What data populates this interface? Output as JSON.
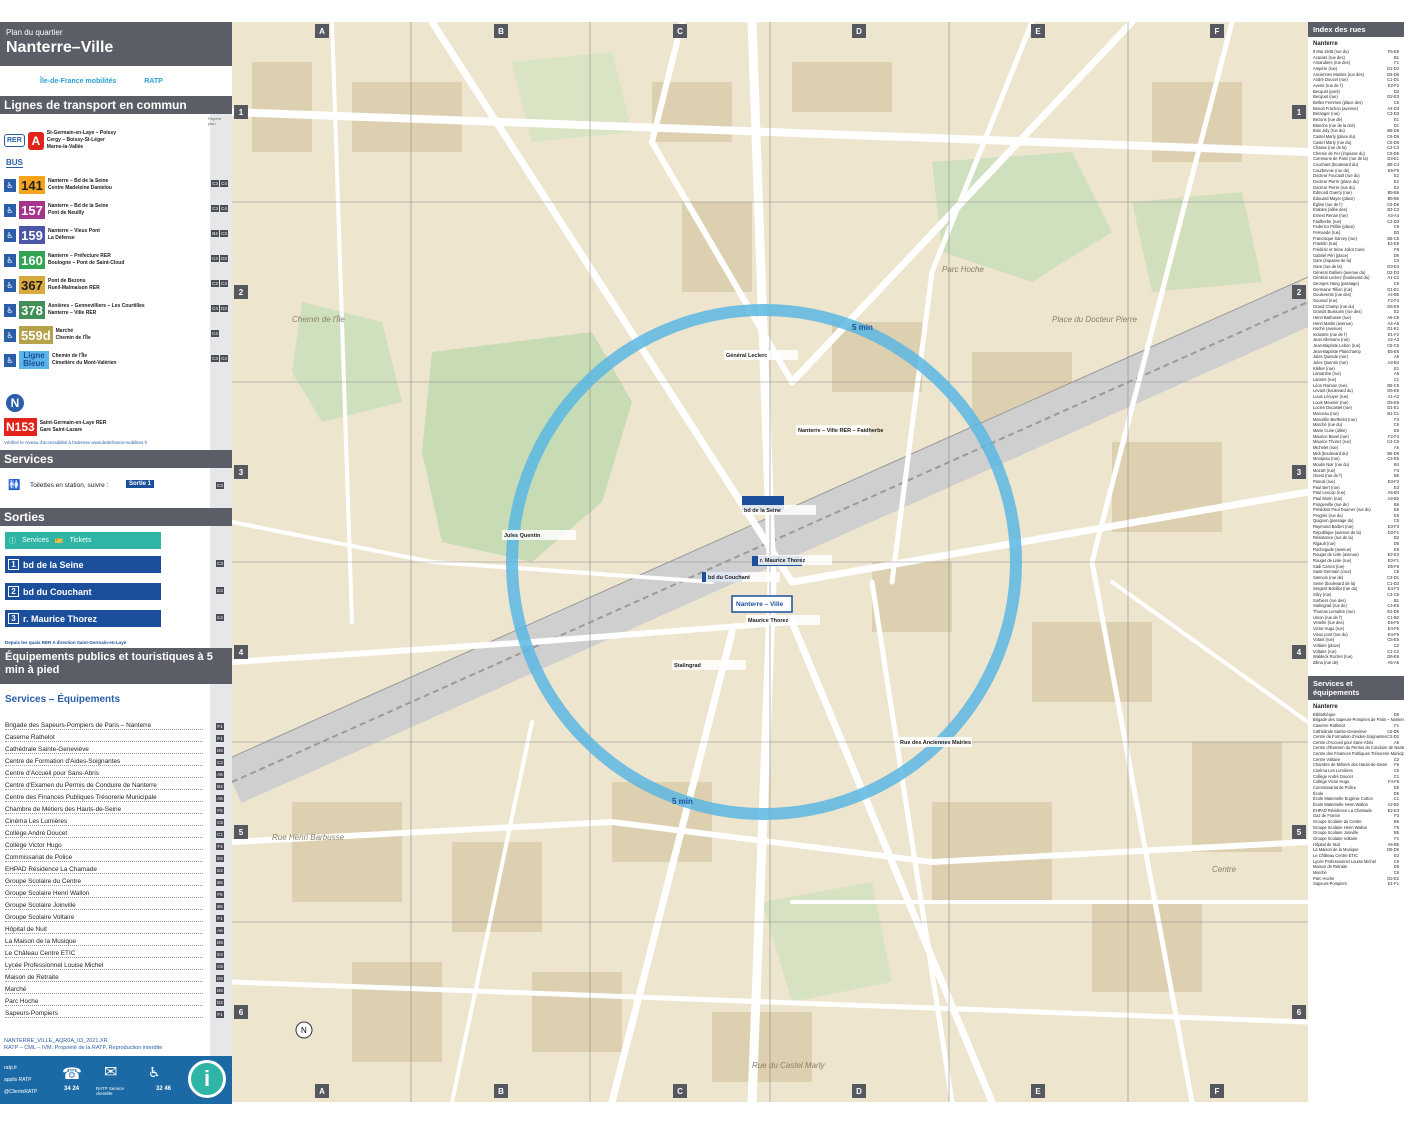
{
  "header": {
    "subtitle": "Plan du quartier",
    "title": "Nanterre–Ville",
    "logo_idf": "Île-de-France mobilités",
    "logo_ratp": "RATP"
  },
  "lines_section": {
    "title": "Lignes de transport en commun",
    "ref_header": "Repère plan",
    "rer": {
      "mode": "RER",
      "line": "A",
      "destinations": [
        "St-Germain-en-Laye – Poissy",
        "Cergy – Boissy-St-Léger",
        "Marne-la-Vallée"
      ]
    },
    "bus_label": "BUS",
    "buses": [
      {
        "num": "141",
        "color": "#f4a31b",
        "text_color": "#1e1e1e",
        "dest1": "Nanterre – Bd de la Seine",
        "dest2": "Centre Madeleine Danielou",
        "refs": [
          "C3",
          "C4"
        ]
      },
      {
        "num": "157",
        "color": "#a4358d",
        "text_color": "#ffffff",
        "dest1": "Nanterre – Bd de la Seine",
        "dest2": "Pont de Neuilly",
        "refs": [
          "C3",
          "C4"
        ]
      },
      {
        "num": "159",
        "color": "#4a57a5",
        "text_color": "#ffffff",
        "dest1": "Nanterre – Vieux Pont",
        "dest2": "La Défense",
        "refs": [
          "B4",
          "C3"
        ]
      },
      {
        "num": "160",
        "color": "#33a354",
        "text_color": "#ffffff",
        "dest1": "Nanterre – Préfecture RER",
        "dest2": "Boulogne – Pont de Saint-Cloud",
        "refs": [
          "C4",
          "D3"
        ]
      },
      {
        "num": "367",
        "color": "#d9a93e",
        "text_color": "#1e1e1e",
        "dest1": "Pont de Bezons",
        "dest2": "Rueil-Malmaison RER",
        "refs": [
          "C3",
          "C4"
        ]
      },
      {
        "num": "378",
        "color": "#3f8f56",
        "text_color": "#ffffff",
        "dest1": "Asnières – Gennevilliers – Les Courtilles",
        "dest2": "Nanterre – Ville RER",
        "refs": [
          "C4",
          "D3"
        ]
      },
      {
        "num": "559d",
        "color": "#b5a24a",
        "text_color": "#ffffff",
        "dest1": "Marché",
        "dest2": "Chemin de l'Île",
        "refs": [
          "C4"
        ]
      },
      {
        "num": "Ligne Bleue",
        "color": "#5ab4e5",
        "text_color": "#1b4f9c",
        "dest1": "Chemin de l'Île",
        "dest2": "Cimetière du Mont-Valérien",
        "refs": [
          "C3",
          "C4"
        ]
      }
    ],
    "noctilien": {
      "label": "N",
      "num": "N153",
      "color": "#e2231a",
      "dest1": "Saint-Germain-en-Laye RER",
      "dest2": "Gare Saint-Lazare"
    },
    "accessibility_note": "Vérifiez le niveau d'accessibilité à l'adresse www.iledefrance-mobilites.fr"
  },
  "services_section": {
    "title": "Services",
    "toilets": "Toilettes en station, suivre :",
    "toilets_exit": "Sortie 1",
    "ref": "C3"
  },
  "exits_section": {
    "title": "Sorties",
    "services_label": "Services",
    "tickets_label": "Tickets",
    "exits": [
      {
        "num": "1",
        "label": "bd de la Seine",
        "ref": "C3"
      },
      {
        "num": "2",
        "label": "bd du Couchant",
        "ref": "C4"
      },
      {
        "num": "3",
        "label": "r. Maurice Thorez",
        "ref": "C4"
      }
    ],
    "quay_note": "Depuis les quais RER A direction Saint-Germain-en-Laye"
  },
  "equipment_section": {
    "title": "Équipements publics et touristiques à 5 min à pied",
    "subtitle": "Services – Équipements",
    "items": [
      {
        "name": "Brigade des Sapeurs-Pompiers de Paris – Nanterre",
        "ref": "F1"
      },
      {
        "name": "Caserne Rathelot",
        "ref": "F1"
      },
      {
        "name": "Cathédrale Sainte-Geneviève",
        "ref": "D6"
      },
      {
        "name": "Centre de Formation d'Aides-Soignantes",
        "ref": "C2"
      },
      {
        "name": "Centre d'Accueil pour Sans-Abris",
        "ref": "A5"
      },
      {
        "name": "Centre d'Examen du Permis de Conduire de Nanterre",
        "ref": "B4"
      },
      {
        "name": "Centre des Finances Publiques Trésorerie Municipale",
        "ref": "A5"
      },
      {
        "name": "Chambre de Métiers des Hauts-de-Seine",
        "ref": "F6"
      },
      {
        "name": "Cinéma Les Lumières",
        "ref": "C5"
      },
      {
        "name": "Collège André Doucet",
        "ref": "C1"
      },
      {
        "name": "Collège Victor Hugo",
        "ref": "F4"
      },
      {
        "name": "Commissariat de Police",
        "ref": "E5"
      },
      {
        "name": "EHPAD Résidence La Chamade",
        "ref": "E2"
      },
      {
        "name": "Groupe Scolaire du Centre",
        "ref": "B6"
      },
      {
        "name": "Groupe Scolaire Henri Wallon",
        "ref": "F5"
      },
      {
        "name": "Groupe Scolaire Joinville",
        "ref": "B5"
      },
      {
        "name": "Groupe Scolaire Voltaire",
        "ref": "F1"
      },
      {
        "name": "Hôpital de Nuit",
        "ref": "A6"
      },
      {
        "name": "La Maison de la Musique",
        "ref": "D5"
      },
      {
        "name": "Le Château Centre ETIC",
        "ref": "E3"
      },
      {
        "name": "Lycée Professionnel Louise Michel",
        "ref": "C6"
      },
      {
        "name": "Maison de Retraite",
        "ref": "D6"
      },
      {
        "name": "Marché",
        "ref": "D6"
      },
      {
        "name": "Parc Hoche",
        "ref": "D2"
      },
      {
        "name": "Sapeurs-Pompiers",
        "ref": "F1"
      }
    ]
  },
  "footer": {
    "code": "NANTERRE_VILLE_AQR0A_03_2021.XR",
    "copyright": "RATP – CML – IVM. Propriété de la RATP. Reproduction interdite",
    "contacts": [
      "ratp.fr",
      "applis RATP",
      "@ClientsRATP",
      "34 24",
      "RATP Service clientèle",
      "32 46"
    ]
  },
  "map": {
    "columns": [
      "A",
      "B",
      "C",
      "D",
      "E",
      "F"
    ],
    "rows": [
      "1",
      "2",
      "3",
      "4",
      "5",
      "6"
    ],
    "walk_label": "5 min",
    "station_label": "Nanterre – Ville",
    "place_labels": [
      {
        "text": "Chemin de l'Île"
      },
      {
        "text": "Centre"
      },
      {
        "text": "Parc Hoche"
      },
      {
        "text": "Place du Docteur Pierre"
      },
      {
        "text": "Rue Henri Barbusse"
      },
      {
        "text": "Rue du Castel Marly"
      }
    ],
    "stop_labels": [
      {
        "text": "Général Leclerc"
      },
      {
        "text": "Nanterre – Ville RER – Faidherbe"
      },
      {
        "text": "Jules Quentin"
      },
      {
        "text": "Maurice Thorez"
      },
      {
        "text": "Stalingrad"
      },
      {
        "text": "Rue des Anciennes Mairies"
      },
      {
        "text": "bd du Couchant"
      },
      {
        "text": "bd de la Seine"
      },
      {
        "text": "r. Maurice Thorez"
      }
    ]
  },
  "street_index": {
    "title": "Index des rues",
    "city": "Nanterre",
    "streets": [
      [
        "8 Mai 1945 (rue du)",
        "F5-E6"
      ],
      [
        "Acacias (rue des)",
        "B1"
      ],
      [
        "Amandiers (rue des)",
        "F1"
      ],
      [
        "Ampère (rue)",
        "D1-D2"
      ],
      [
        "Anciennes Mairies (rue des)",
        "D5-D6"
      ],
      [
        "André Doucet (rue)",
        "C1-D1"
      ],
      [
        "Avenir (rue de l')",
        "E2-F2"
      ],
      [
        "Becquet (pont)",
        "D2"
      ],
      [
        "Becquet (rue)",
        "D2-E3"
      ],
      [
        "Belles Femmes (place des)",
        "C6"
      ],
      [
        "Benoit Frachon (avenue)",
        "A4-D3"
      ],
      [
        "Béranger (rue)",
        "C3-D3"
      ],
      [
        "Bezons (rue de)",
        "E1"
      ],
      [
        "Blanche (rue de la cité)",
        "D1"
      ],
      [
        "Bois Joly (rue du)",
        "B5-D5"
      ],
      [
        "Castel Marly (place du)",
        "C6-D6"
      ],
      [
        "Castel Marly (rue du)",
        "C6-D6"
      ],
      [
        "Chasse (rue de la)",
        "C2-C3"
      ],
      [
        "Chemin de Fer (impasse du)",
        "C5-D5"
      ],
      [
        "Commune de Paris (rue de la)",
        "D3-E1"
      ],
      [
        "Couchant (boulevard du)",
        "B5-C4"
      ],
      [
        "Courbevoie (rue de)",
        "E6-F5"
      ],
      [
        "Docteur Foucault (rue du)",
        "E2"
      ],
      [
        "Docteur Pierre (place du)",
        "E2"
      ],
      [
        "Docteur Pierre (rue du)",
        "E2"
      ],
      [
        "Edmond Guerry (rue)",
        "B5-B6"
      ],
      [
        "Édouard Mayer (place)",
        "B5-B6"
      ],
      [
        "Église (rue de l')",
        "C6-D6"
      ],
      [
        "Érables (allée des)",
        "B3-C3"
      ],
      [
        "Ernest Renan (rue)",
        "A3-A4"
      ],
      [
        "Faidherbe (rue)",
        "C2-D3"
      ],
      [
        "Federico Pellini (place)",
        "C5"
      ],
      [
        "Fernande (rue)",
        "B3"
      ],
      [
        "Francisque Sarcey (rue)",
        "B5-C5"
      ],
      [
        "Franklin (rue)",
        "E4-E5"
      ],
      [
        "Frédéric et Irène Joliot Curie",
        "F6"
      ],
      [
        "Gabriel Péri (place)",
        "D6"
      ],
      [
        "Gare (impasse de la)",
        "C3"
      ],
      [
        "Gare (rue de la)",
        "D3-E3"
      ],
      [
        "Général Gallieni (avenue du)",
        "D2-D3"
      ],
      [
        "Général Leclerc (boulevard du)",
        "A1-C2"
      ],
      [
        "Georges Hang (passage)",
        "C6"
      ],
      [
        "Germaine Tillion (rue)",
        "D1-E1"
      ],
      [
        "Goulevents (rue des)",
        "A4-B5"
      ],
      [
        "Gounod (rue)",
        "F2-F3"
      ],
      [
        "Grand Champ (rue du)",
        "D6-E6"
      ],
      [
        "Grands Buissons (rue des)",
        "E2"
      ],
      [
        "Henri Barbusse (rue)",
        "A5-C5"
      ],
      [
        "Henri Martin (avenue)",
        "A4-A5"
      ],
      [
        "Hoche (avenue)",
        "D1-E1"
      ],
      [
        "Industrie (rue de l')",
        "E1-F2"
      ],
      [
        "Jean Allemane (rue)",
        "A2-A3"
      ],
      [
        "Jean-Baptiste Lebon (rue)",
        "C5-C6"
      ],
      [
        "Jean-Baptiste Plaincharnp",
        "E5-E6"
      ],
      [
        "Jules Quesde (rue)",
        "A6"
      ],
      [
        "Jules Quentin (rue)",
        "A3-B4"
      ],
      [
        "Kléber (rue)",
        "E1"
      ],
      [
        "Lamartine (rue)",
        "A6"
      ],
      [
        "Lannes (rue)",
        "C1"
      ],
      [
        "Léon Raimon (rue)",
        "B5-C5"
      ],
      [
        "Levant (boulevard du)",
        "D5-E6"
      ],
      [
        "Louis Lécuyer (rue)",
        "A1-A2"
      ],
      [
        "Louis Meunier (rue)",
        "D5-E6"
      ],
      [
        "Lucien Ducastel (rue)",
        "D1-E1"
      ],
      [
        "Marceau (rue)",
        "B1-C1"
      ],
      [
        "Marcellin Berthelot (rue)",
        "F3"
      ],
      [
        "Marché (rue du)",
        "C6"
      ],
      [
        "Marie Curie (allée)",
        "E6"
      ],
      [
        "Maurice Bavel (rue)",
        "F2-F3"
      ],
      [
        "Maurice Thorez (rue)",
        "C4-C6"
      ],
      [
        "Michelet (rue)",
        "A6"
      ],
      [
        "Midi (boulevard du)",
        "B6-D6"
      ],
      [
        "Montjeau (rue)",
        "C4-E5"
      ],
      [
        "Moulin Noir (rue du)",
        "B4"
      ],
      [
        "Mozart (rue)",
        "F3"
      ],
      [
        "Ouest (rue de l')",
        "B6"
      ],
      [
        "Pascal (rue)",
        "E3-F2"
      ],
      [
        "Paul Bert (rue)",
        "E3"
      ],
      [
        "Paul Lescop (rue)",
        "A5-B4"
      ],
      [
        "Paul Morin (rue)",
        "A3-B2"
      ],
      [
        "Pongerville (rue de)",
        "B6"
      ],
      [
        "Président Paul Doumer (rue du)",
        "E6"
      ],
      [
        "Progrès (rue du)",
        "E5"
      ],
      [
        "Quignon (passage du)",
        "C5"
      ],
      [
        "Raymond Barbet (rue)",
        "E3-F3"
      ],
      [
        "République (avenue de la)",
        "D3-F1"
      ],
      [
        "Résistance (rue de la)",
        "B2"
      ],
      [
        "Rigault (rue)",
        "D6"
      ],
      [
        "Rochegude (avenue)",
        "E6"
      ],
      [
        "Rouget de Lisle (avenue)",
        "E2-E3"
      ],
      [
        "Rouget de Lisle (rue)",
        "E3-F1"
      ],
      [
        "Sadi Carnot (rue)",
        "D6-F6"
      ],
      [
        "Saint-Germain (cour)",
        "C5"
      ],
      [
        "Sannois (rue de)",
        "C2-D1"
      ],
      [
        "Seine (boulevard de la)",
        "C1-D3"
      ],
      [
        "Sergent Bobillot (rue du)",
        "E4-F3"
      ],
      [
        "Silvy (rue)",
        "C4-C5"
      ],
      [
        "Sorbiers (rue des)",
        "B1"
      ],
      [
        "Stalingrad (rue de)",
        "C4-E5"
      ],
      [
        "Thomas Lemaître (rue)",
        "E4-D6"
      ],
      [
        "Union (rue de l')",
        "C1-B2"
      ],
      [
        "Venelle (rue des)",
        "E6-F6"
      ],
      [
        "Victor Hugo (rue)",
        "E4-F5"
      ],
      [
        "Vieux pont (rue du)",
        "E4-F5"
      ],
      [
        "Volant (rue)",
        "C5-E5"
      ],
      [
        "Voltaire (place)",
        "C2"
      ],
      [
        "Voltaire (rue)",
        "C1-C2"
      ],
      [
        "Waldeck Rochet (rue)",
        "D6-E6"
      ],
      [
        "Zilina (rue de)",
        "A5-A6"
      ]
    ]
  },
  "services_index": {
    "title": "Services et équipements",
    "city": "Nanterre",
    "items": [
      [
        "Bibliothèque",
        "D6"
      ],
      [
        "Brigade des Sapeurs-Pompiers de Paris – Nanterre",
        "E1-F1"
      ],
      [
        "Caserne Rathelot",
        "F1"
      ],
      [
        "Cathédrale Sainte-Geneviève",
        "C6-D6"
      ],
      [
        "Centre de Formation d'Aides-Soignantes",
        "C2-D2"
      ],
      [
        "Centre d'Accueil pour Sans-Abris",
        "A5"
      ],
      [
        "Centre d'Examen du Permis de Conduire de Nanterre",
        "B3-B4"
      ],
      [
        "Centre des Finances Publiques Trésorerie Municipale",
        "A5-B5"
      ],
      [
        "Centre Voltaire",
        "C2"
      ],
      [
        "Chambre de Métiers des Hauts-de-Seine",
        "F6"
      ],
      [
        "Cinéma Les Lumières",
        "C5"
      ],
      [
        "Collège André Doucet",
        "C1"
      ],
      [
        "Collège Victor Hugo",
        "F4-F5"
      ],
      [
        "Commissariat de Police",
        "E5"
      ],
      [
        "École",
        "D5"
      ],
      [
        "École Maternelle Eugénie Cotton",
        "C1"
      ],
      [
        "École Maternelle Henri Wallon",
        "A2-B2"
      ],
      [
        "EHPAD Résidence La Chamade",
        "E2-E3"
      ],
      [
        "Gaz de France",
        "F3"
      ],
      [
        "Groupe Scolaire du Centre",
        "B6"
      ],
      [
        "Groupe Scolaire Henri Wallon",
        "F5"
      ],
      [
        "Groupe Scolaire Joinville",
        "B5"
      ],
      [
        "Groupe Scolaire Voltaire",
        "F1"
      ],
      [
        "Hôpital de Nuit",
        "A6-B6"
      ],
      [
        "La Maison de la Musique",
        "D5-D6"
      ],
      [
        "Le Château Centre ETIC",
        "E3"
      ],
      [
        "Lycée Professionnel Louise Michel",
        "C6"
      ],
      [
        "Maison de Retraite",
        "D6"
      ],
      [
        "Marché",
        "C6"
      ],
      [
        "Parc Hoche",
        "D2-E2"
      ],
      [
        "Sapeurs-Pompiers",
        "E1-F1"
      ]
    ]
  }
}
